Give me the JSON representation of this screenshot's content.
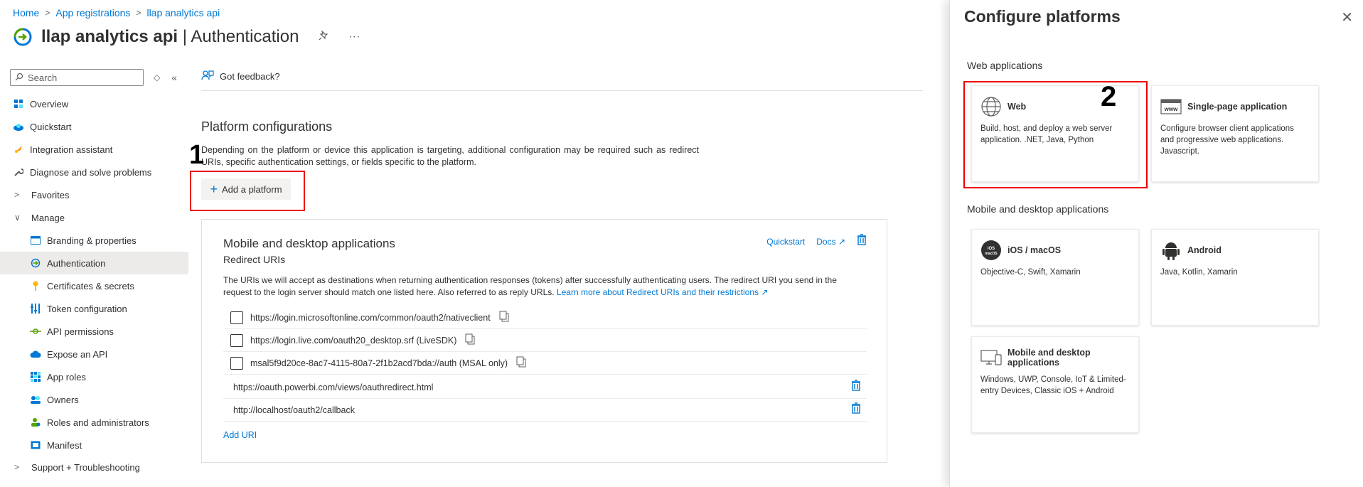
{
  "breadcrumb": [
    "Home",
    "App registrations",
    "llap analytics api"
  ],
  "header": {
    "app_name": "llap analytics api",
    "sep": " | ",
    "page": "Authentication",
    "more": "···"
  },
  "sidebar": {
    "search_placeholder": "Search",
    "items": [
      {
        "label": "Overview",
        "icon": "overview-icon"
      },
      {
        "label": "Quickstart",
        "icon": "quickstart-icon"
      },
      {
        "label": "Integration assistant",
        "icon": "rocket-icon"
      },
      {
        "label": "Diagnose and solve problems",
        "icon": "wrench-icon"
      },
      {
        "label": "Favorites",
        "icon": "chevron-right-icon"
      },
      {
        "label": "Manage",
        "icon": "chevron-down-icon"
      },
      {
        "label": "Branding & properties",
        "icon": "branding-icon"
      },
      {
        "label": "Authentication",
        "icon": "authentication-icon"
      },
      {
        "label": "Certificates & secrets",
        "icon": "key-icon"
      },
      {
        "label": "Token configuration",
        "icon": "token-icon"
      },
      {
        "label": "API permissions",
        "icon": "permissions-icon"
      },
      {
        "label": "Expose an API",
        "icon": "cloud-icon"
      },
      {
        "label": "App roles",
        "icon": "roles-icon"
      },
      {
        "label": "Owners",
        "icon": "owners-icon"
      },
      {
        "label": "Roles and administrators",
        "icon": "admins-icon"
      },
      {
        "label": "Manifest",
        "icon": "manifest-icon"
      },
      {
        "label": "Support + Troubleshooting",
        "icon": "chevron-right-icon"
      }
    ]
  },
  "toolbar": {
    "feedback": "Got feedback?"
  },
  "main": {
    "title": "Platform configurations",
    "desc": "Depending on the platform or device this application is targeting, additional configuration may be required such as redirect URIs, specific authentication settings, or fields specific to the platform.",
    "add_platform": "Add a platform",
    "marker1": "1"
  },
  "card": {
    "title": "Mobile and desktop applications",
    "subtitle": "Redirect URIs",
    "quickstart": "Quickstart",
    "docs": "Docs",
    "info": "The URIs we will accept as destinations when returning authentication responses (tokens) after successfully authenticating users. The redirect URI you send in the request to the login server should match one listed here. Also referred to as reply URLs.",
    "info_link": "Learn more about Redirect URIs and their restrictions",
    "checkbox_uris": [
      "https://login.microsoftonline.com/common/oauth2/nativeclient",
      "https://login.live.com/oauth20_desktop.srf (LiveSDK)",
      "msal5f9d20ce-8ac7-4115-80a7-2f1b2acd7bda://auth (MSAL only)"
    ],
    "custom_uris": [
      "https://oauth.powerbi.com/views/oauthredirect.html",
      "http://localhost/oauth2/callback"
    ],
    "add_uri": "Add URI"
  },
  "panel": {
    "title": "Configure platforms",
    "web_section": "Web applications",
    "mobile_section": "Mobile and desktop applications",
    "marker2": "2",
    "tiles": [
      {
        "name": "Web",
        "desc": "Build, host, and deploy a web server application. .NET, Java, Python"
      },
      {
        "name": "Single-page application",
        "desc": "Configure browser client applications and progressive web applications. Javascript."
      },
      {
        "name": "iOS / macOS",
        "desc": "Objective-C, Swift, Xamarin"
      },
      {
        "name": "Android",
        "desc": "Java, Kotlin, Xamarin"
      },
      {
        "name": "Mobile and desktop applications",
        "desc": "Windows, UWP, Console, IoT & Limited-entry Devices, Classic iOS + Android"
      }
    ]
  },
  "colors": {
    "accent": "#0078d4",
    "highlight": "#e00000"
  }
}
